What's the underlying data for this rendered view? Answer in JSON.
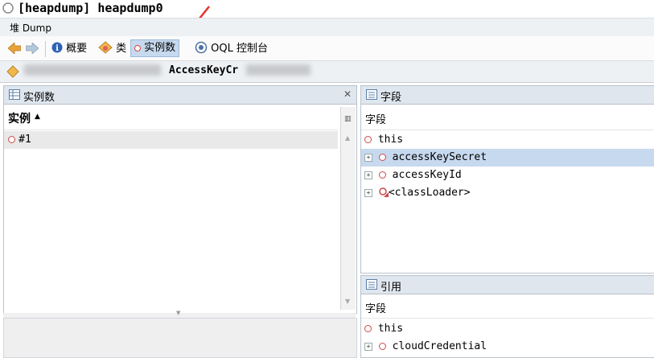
{
  "window": {
    "title": "[heapdump] heapdump0"
  },
  "subtab": {
    "label": "堆 Dump"
  },
  "toolbar": {
    "summary_label": "概要",
    "classes_label": "类",
    "instances_label": "实例数",
    "oql_label": "OQL 控制台"
  },
  "path": {
    "class_label": "AccessKeyCr"
  },
  "instances_panel": {
    "title": "实例数",
    "column_header": "实例",
    "sort_indicator": "▲",
    "rows": [
      "#1"
    ]
  },
  "fields_panel": {
    "title": "字段",
    "column_header": "字段",
    "rows": [
      "this",
      "accessKeySecret",
      "accessKeyId",
      "<classLoader>"
    ]
  },
  "references_panel": {
    "title": "引用",
    "column_header": "字段",
    "rows": [
      "this",
      "cloudCredential"
    ]
  },
  "colors": {
    "selection": "#c7d9ee",
    "header": "#dfe6ee",
    "instance_icon": "#d04848"
  }
}
